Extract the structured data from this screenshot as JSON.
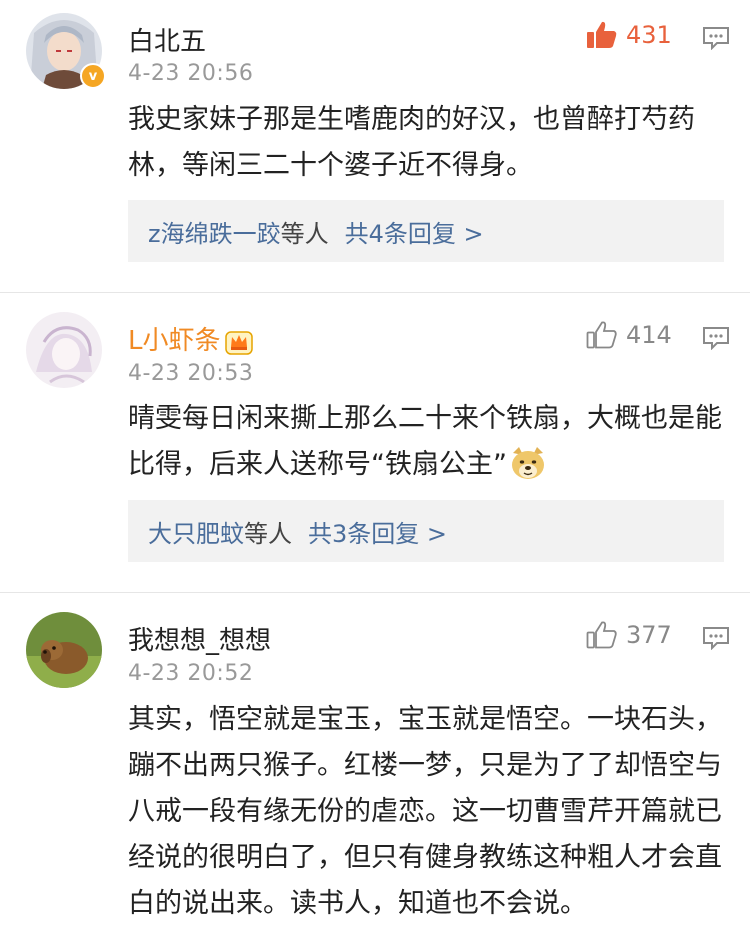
{
  "comments": [
    {
      "username": "白北五",
      "timestamp": "4-23 20:56",
      "likes": "431",
      "liked": true,
      "verified": true,
      "text": "我史家妹子那是生嗜鹿肉的好汉，也曾醉打芍药林，等闲三二十个婆子近不得身。",
      "reply_names": "z海绵跌一跤",
      "reply_etal": "等人",
      "reply_count": "共4条回复 >"
    },
    {
      "username": "L小虾条",
      "timestamp": "4-23 20:53",
      "likes": "414",
      "liked": false,
      "vip": true,
      "text": "晴雯每日闲来撕上那么二十来个铁扇，大概也是能比得，后来人送称号“铁扇公主”",
      "emoji": "doge-emoji",
      "reply_names": "大只肥蚊",
      "reply_etal": "等人",
      "reply_count": "共3条回复 >"
    },
    {
      "username": "我想想_想想",
      "timestamp": "4-23 20:52",
      "likes": "377",
      "liked": false,
      "text": "其实，悟空就是宝玉，宝玉就是悟空。一块石头，蹦不出两只猴子。红楼一梦，只是为了了却悟空与八戒一段有缘无份的虐恋。这一切曹雪芹开篇就已经说的很明白了，但只有健身教练这种粗人才会直白的说出来。读书人，知道也不会说。"
    }
  ],
  "colors": {
    "liked": "#e8613c",
    "link": "#4a6d9b",
    "vip_name": "#f08a24",
    "timestamp": "#999999",
    "reply_bg": "#f2f2f2"
  },
  "icons": {
    "like": "thumbs-up-icon",
    "reply": "comment-icon",
    "verified": "verified-badge-icon",
    "vip": "crown-icon"
  }
}
